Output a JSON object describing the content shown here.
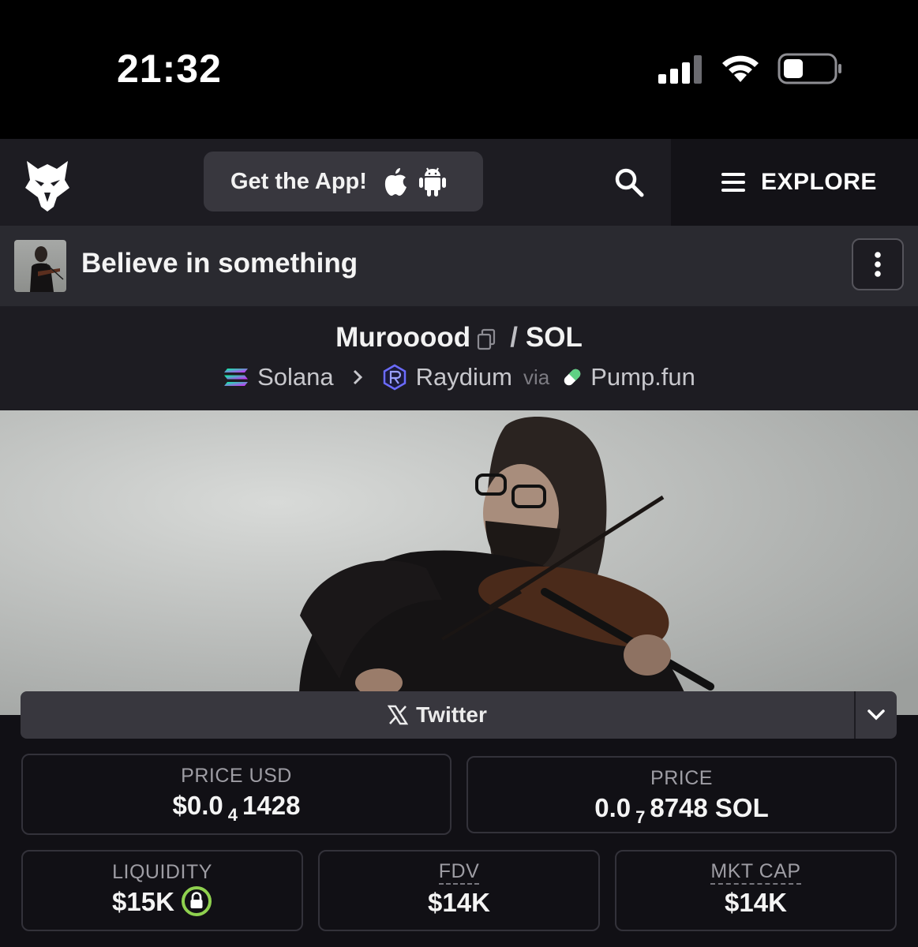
{
  "status_bar": {
    "time": "21:32",
    "icons": [
      "signal-icon",
      "wifi-icon",
      "battery-icon"
    ]
  },
  "nav": {
    "logo": "eagle-logo",
    "get_app_label": "Get the App!",
    "explore_label": "EXPLORE"
  },
  "token": {
    "name": "Believe in something"
  },
  "pair": {
    "base": "Murooood",
    "separator": "/",
    "quote": "SOL",
    "chain": "Solana",
    "dex": "Raydium",
    "via": "via",
    "launchpad": "Pump.fun"
  },
  "socials": {
    "twitter_label": "Twitter"
  },
  "stats": {
    "price_usd": {
      "label": "PRICE USD",
      "prefix": "$0.0",
      "zeros": "4",
      "digits": "1428"
    },
    "price": {
      "label": "PRICE",
      "prefix": "0.0",
      "zeros": "7",
      "digits": "8748 SOL"
    },
    "liquidity": {
      "label": "LIQUIDITY",
      "value": "$15K"
    },
    "fdv": {
      "label": "FDV",
      "value": "$14K"
    },
    "mkt_cap": {
      "label": "MKT CAP",
      "value": "$14K"
    }
  },
  "colors": {
    "nav_bg": "#1d1c22",
    "header_bg": "#2a2a30",
    "button_bg": "#38373e",
    "lock_ring": "#8fd14f"
  }
}
